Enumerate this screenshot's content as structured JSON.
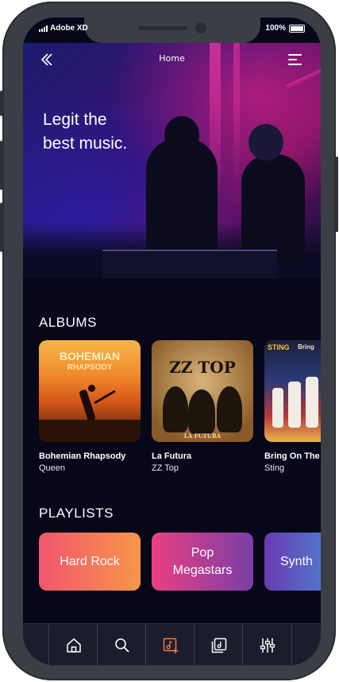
{
  "status_bar": {
    "carrier": "Adobe XD",
    "battery": "100%"
  },
  "header": {
    "title": "Home"
  },
  "hero": {
    "headline": "Legit the\nbest music."
  },
  "albums": {
    "section_title": "ALBUMS",
    "items": [
      {
        "title": "Bohemian Rhapsody",
        "artist": "Queen",
        "cover_text": [
          "BOHEMIAN",
          "RHAPSODY"
        ]
      },
      {
        "title": "La Futura",
        "artist": "ZZ Top",
        "cover_text": [
          "ZZ TOP",
          "LA FUTURA"
        ]
      },
      {
        "title": "Bring On The",
        "artist": "Sting",
        "cover_text": [
          "STING",
          "Bring"
        ]
      }
    ]
  },
  "playlists": {
    "section_title": "PLAYLISTS",
    "items": [
      {
        "label": "Hard Rock",
        "colors": [
          "#f2556f",
          "#f7964a"
        ]
      },
      {
        "label": "Pop\nMegastars",
        "colors": [
          "#ea3f82",
          "#7b3ea6"
        ]
      },
      {
        "label": "Synth",
        "colors": [
          "#6a3ab0",
          "#3ea0e0"
        ]
      }
    ]
  },
  "tab_bar": {
    "items": [
      {
        "icon": "home-icon",
        "active": false
      },
      {
        "icon": "search-icon",
        "active": false
      },
      {
        "icon": "music-library-add-icon",
        "active": true
      },
      {
        "icon": "playlist-icon",
        "active": false
      },
      {
        "icon": "equalizer-icon",
        "active": false
      }
    ],
    "active_color": "#f07b3f",
    "inactive_color": "#ffffff"
  },
  "colors": {
    "background": "#08071a",
    "tab_bar": "#1b1d2d",
    "accent": "#f07b3f"
  }
}
